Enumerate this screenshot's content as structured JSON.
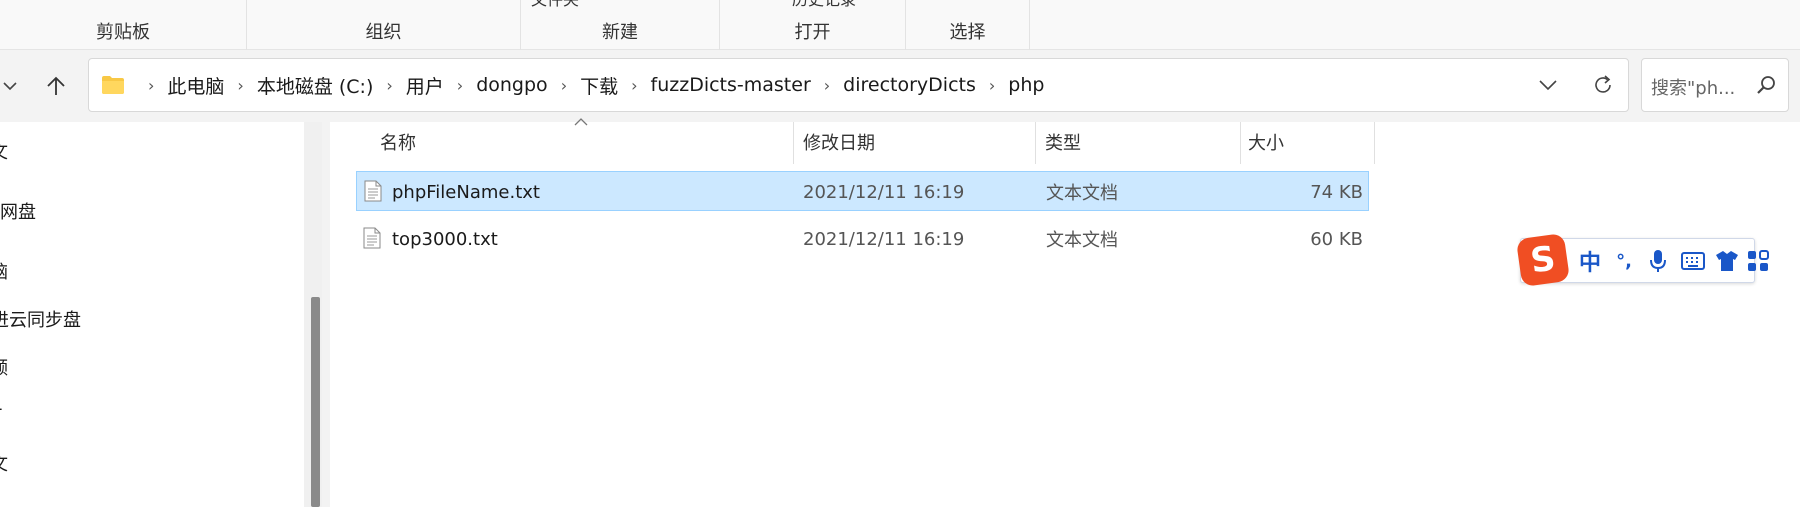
{
  "ribbon": {
    "groups": [
      {
        "label": "剪贴板"
      },
      {
        "label": "组织"
      },
      {
        "label": "新建",
        "cut_text": "文件夹"
      },
      {
        "label": "打开",
        "cut_text": "历史记录"
      },
      {
        "label": "选择"
      }
    ]
  },
  "address": {
    "crumbs": [
      "此电脑",
      "本地磁盘 (C:)",
      "用户",
      "dongpo",
      "下载",
      "fuzzDicts-master",
      "directoryDicts",
      "php"
    ]
  },
  "search": {
    "placeholder": "搜索\"ph..."
  },
  "navpane": {
    "items": [
      "文",
      "网盘",
      "脑",
      "进云同步盘",
      "频",
      "-",
      "文"
    ]
  },
  "columns": {
    "name": "名称",
    "date": "修改日期",
    "type": "类型",
    "size": "大小"
  },
  "files": [
    {
      "name": "phpFileName.txt",
      "date": "2021/12/11 16:19",
      "type": "文本文档",
      "size": "74 KB",
      "selected": true
    },
    {
      "name": "top3000.txt",
      "date": "2021/12/11 16:19",
      "type": "文本文档",
      "size": "60 KB",
      "selected": false
    }
  ],
  "ime": {
    "mode_label": "中",
    "punct_label": "°,",
    "logo_text": "S"
  },
  "colors": {
    "selection_bg": "#cce8ff",
    "selection_border": "#99d1ff",
    "ime_blue": "#1a57c8",
    "ime_logo": "#f04e23"
  }
}
